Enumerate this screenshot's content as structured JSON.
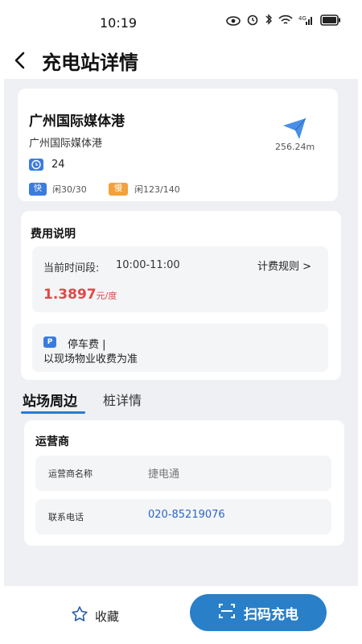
{
  "status_bar": {
    "time": "10:19",
    "network": "4G"
  },
  "nav": {
    "title": "充电站详情"
  },
  "station": {
    "name": "广州国际媒体港",
    "address": "广州国际媒体港",
    "distance": "256.24m",
    "count": "24",
    "fast_badge": "快",
    "fast_idle": "闲30/30",
    "slow_badge": "慢",
    "slow_idle": "闲123/140"
  },
  "fee": {
    "title": "费用说明",
    "period_label": "当前时间段:",
    "period_value": "10:00-11:00",
    "rule_link": "计费规则 >",
    "price": "1.3897",
    "price_unit": "元/度",
    "parking_icon": "P",
    "parking_title": "停车费 |",
    "parking_desc": "以现场物业收费为准"
  },
  "tabs": {
    "station": "站场周边",
    "pile": "桩详情"
  },
  "operator": {
    "title": "运营商",
    "name_label": "运营商名称",
    "name_value": "捷电通",
    "phone_label": "联系电话",
    "phone_value": "020-85219076"
  },
  "bottom": {
    "favorite": "收藏",
    "scan": "扫码充电"
  },
  "colors": {
    "accent": "#2a80c8",
    "price": "#e04848",
    "fast": "#3b7be0",
    "slow": "#f3a13a"
  }
}
